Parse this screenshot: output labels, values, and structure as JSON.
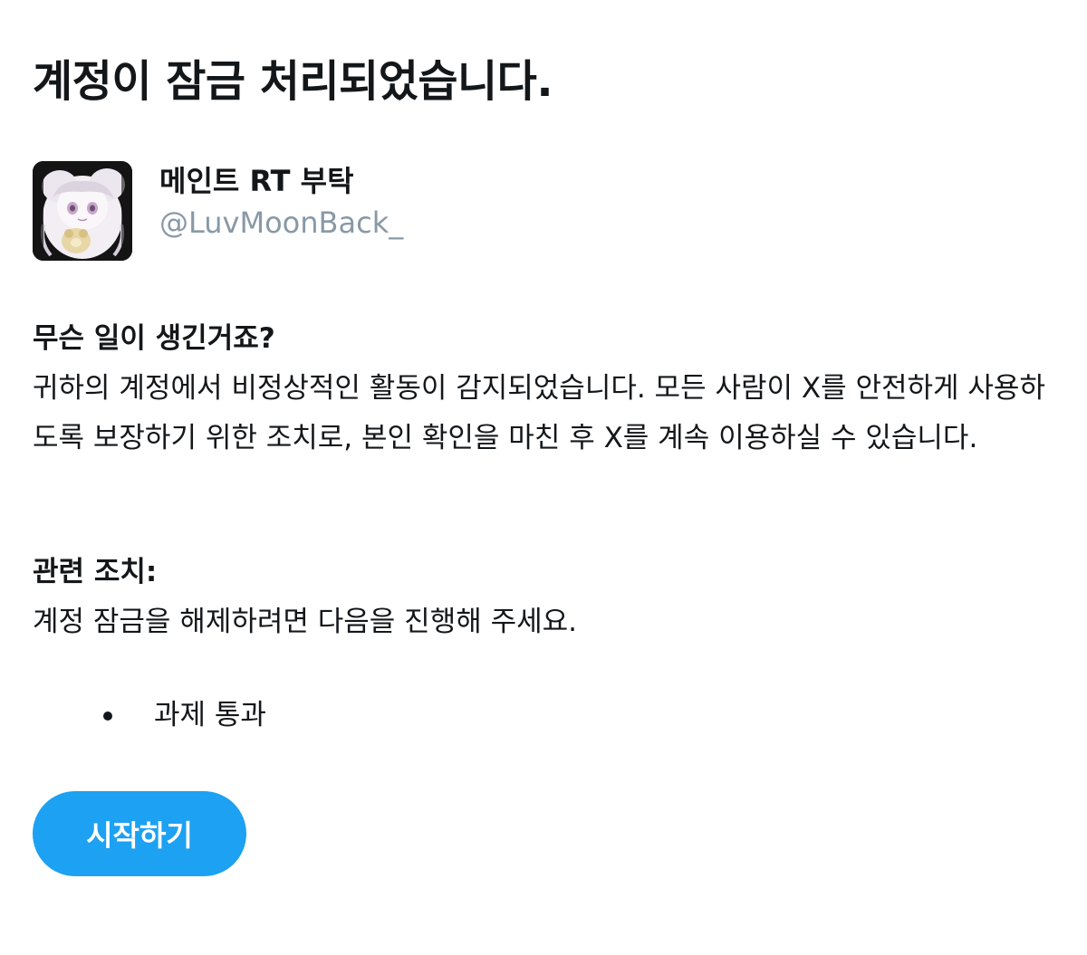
{
  "page": {
    "title": "계정이 잠금 처리되었습니다."
  },
  "account": {
    "display_name": "메인트 RT 부탁",
    "handle": "@LuvMoonBack_"
  },
  "what_happened": {
    "heading": "무슨 일이 생긴거죠?",
    "body": "귀하의 계정에서 비정상적인 활동이 감지되었습니다. 모든 사람이 X를 안전하게 사용하도록 보장하기 위한 조치로, 본인 확인을 마친 후 X를 계속 이용하실 수 있습니다."
  },
  "related_actions": {
    "heading": "관련 조치:",
    "body": "계정 잠금을 해제하려면 다음을 진행해 주세요.",
    "items": [
      {
        "label": "과제 통과"
      }
    ]
  },
  "start_button": {
    "label": "시작하기",
    "color": "#1da1f2"
  },
  "colors": {
    "text": "#14171a",
    "handle": "#8899a6",
    "background": "#ffffff"
  }
}
